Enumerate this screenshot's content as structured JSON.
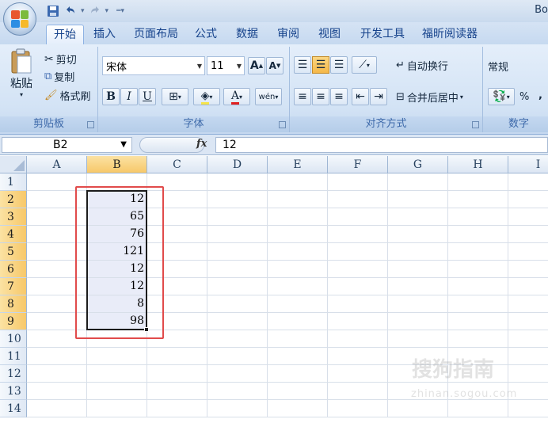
{
  "window": {
    "title": "Bo"
  },
  "quick_access": {
    "save_icon": "save-icon",
    "undo_icon": "undo-icon",
    "redo_icon": "redo-icon",
    "customize_icon": "customize-arrow-icon"
  },
  "tabs": [
    {
      "label": "开始",
      "active": true
    },
    {
      "label": "插入"
    },
    {
      "label": "页面布局"
    },
    {
      "label": "公式"
    },
    {
      "label": "数据"
    },
    {
      "label": "审阅"
    },
    {
      "label": "视图"
    },
    {
      "label": "开发工具"
    },
    {
      "label": "福昕阅读器"
    }
  ],
  "ribbon": {
    "clipboard": {
      "paste": "粘贴",
      "cut": "剪切",
      "copy": "复制",
      "format_painter": "格式刷",
      "group_label": "剪贴板"
    },
    "font": {
      "font_name": "宋体",
      "font_size": "11",
      "grow": "A",
      "shrink": "A",
      "bold": "B",
      "italic": "I",
      "underline": "U",
      "phonetic": "wén",
      "group_label": "字体"
    },
    "alignment": {
      "wrap_text": "自动换行",
      "merge_center": "合并后居中",
      "group_label": "对齐方式"
    },
    "number": {
      "format": "常规",
      "percent": "%",
      "comma": ",",
      "group_label": "数字"
    }
  },
  "formula_bar": {
    "name_box": "B2",
    "fx_label": "fx",
    "formula": "12"
  },
  "sheet": {
    "columns": [
      "A",
      "B",
      "C",
      "D",
      "E",
      "F",
      "G",
      "H",
      "I"
    ],
    "selected_column": "B",
    "rows": [
      "1",
      "2",
      "3",
      "4",
      "5",
      "6",
      "7",
      "8",
      "9",
      "10",
      "11",
      "12",
      "13",
      "14"
    ],
    "selected_rows": [
      "2",
      "3",
      "4",
      "5",
      "6",
      "7",
      "8",
      "9"
    ],
    "b_values": [
      "",
      "12",
      "65",
      "76",
      "121",
      "12",
      "12",
      "8",
      "98",
      "",
      "",
      "",
      "",
      ""
    ]
  },
  "watermark": {
    "text": "搜狗指南",
    "sub": "zhinan.sogou.com"
  },
  "colors": {
    "selection_border": "#1c1c1c",
    "annotation_border": "#e14b4b",
    "selected_header": "#f7c869",
    "range_fill": "#e9ecf8"
  }
}
